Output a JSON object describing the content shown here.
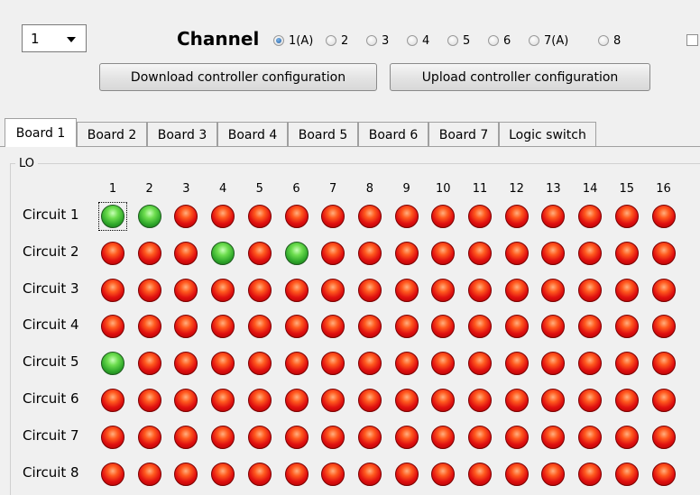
{
  "board_select": {
    "value": "1"
  },
  "channel": {
    "label": "Channel",
    "options": [
      "1(A)",
      "2",
      "3",
      "4",
      "5",
      "6",
      "7(A)",
      "8"
    ],
    "selected_index": 0
  },
  "buttons": {
    "download": "Download controller configuration",
    "upload": "Upload controller configuration"
  },
  "tabs": [
    {
      "label": "Board 1",
      "active": true
    },
    {
      "label": "Board 2",
      "active": false
    },
    {
      "label": "Board 3",
      "active": false
    },
    {
      "label": "Board 4",
      "active": false
    },
    {
      "label": "Board 5",
      "active": false
    },
    {
      "label": "Board 6",
      "active": false
    },
    {
      "label": "Board 7",
      "active": false
    },
    {
      "label": "Logic switch",
      "active": false
    }
  ],
  "group": {
    "label": "LO"
  },
  "columns": [
    "1",
    "2",
    "3",
    "4",
    "5",
    "6",
    "7",
    "8",
    "9",
    "10",
    "11",
    "12",
    "13",
    "14",
    "15",
    "16"
  ],
  "circuits": [
    {
      "label": "Circuit 1",
      "states": [
        "green",
        "green",
        "red",
        "red",
        "red",
        "red",
        "red",
        "red",
        "red",
        "red",
        "red",
        "red",
        "red",
        "red",
        "red",
        "red"
      ]
    },
    {
      "label": "Circuit 2",
      "states": [
        "red",
        "red",
        "red",
        "green",
        "red",
        "green",
        "red",
        "red",
        "red",
        "red",
        "red",
        "red",
        "red",
        "red",
        "red",
        "red"
      ]
    },
    {
      "label": "Circuit 3",
      "states": [
        "red",
        "red",
        "red",
        "red",
        "red",
        "red",
        "red",
        "red",
        "red",
        "red",
        "red",
        "red",
        "red",
        "red",
        "red",
        "red"
      ]
    },
    {
      "label": "Circuit 4",
      "states": [
        "red",
        "red",
        "red",
        "red",
        "red",
        "red",
        "red",
        "red",
        "red",
        "red",
        "red",
        "red",
        "red",
        "red",
        "red",
        "red"
      ]
    },
    {
      "label": "Circuit 5",
      "states": [
        "green",
        "red",
        "red",
        "red",
        "red",
        "red",
        "red",
        "red",
        "red",
        "red",
        "red",
        "red",
        "red",
        "red",
        "red",
        "red"
      ]
    },
    {
      "label": "Circuit 6",
      "states": [
        "red",
        "red",
        "red",
        "red",
        "red",
        "red",
        "red",
        "red",
        "red",
        "red",
        "red",
        "red",
        "red",
        "red",
        "red",
        "red"
      ]
    },
    {
      "label": "Circuit 7",
      "states": [
        "red",
        "red",
        "red",
        "red",
        "red",
        "red",
        "red",
        "red",
        "red",
        "red",
        "red",
        "red",
        "red",
        "red",
        "red",
        "red"
      ]
    },
    {
      "label": "Circuit 8",
      "states": [
        "red",
        "red",
        "red",
        "red",
        "red",
        "red",
        "red",
        "red",
        "red",
        "red",
        "red",
        "red",
        "red",
        "red",
        "red",
        "red"
      ]
    }
  ],
  "colors": {
    "led_on": "#2ea62a",
    "led_off": "#e01010",
    "radio_selected": "#1e5fa8"
  }
}
